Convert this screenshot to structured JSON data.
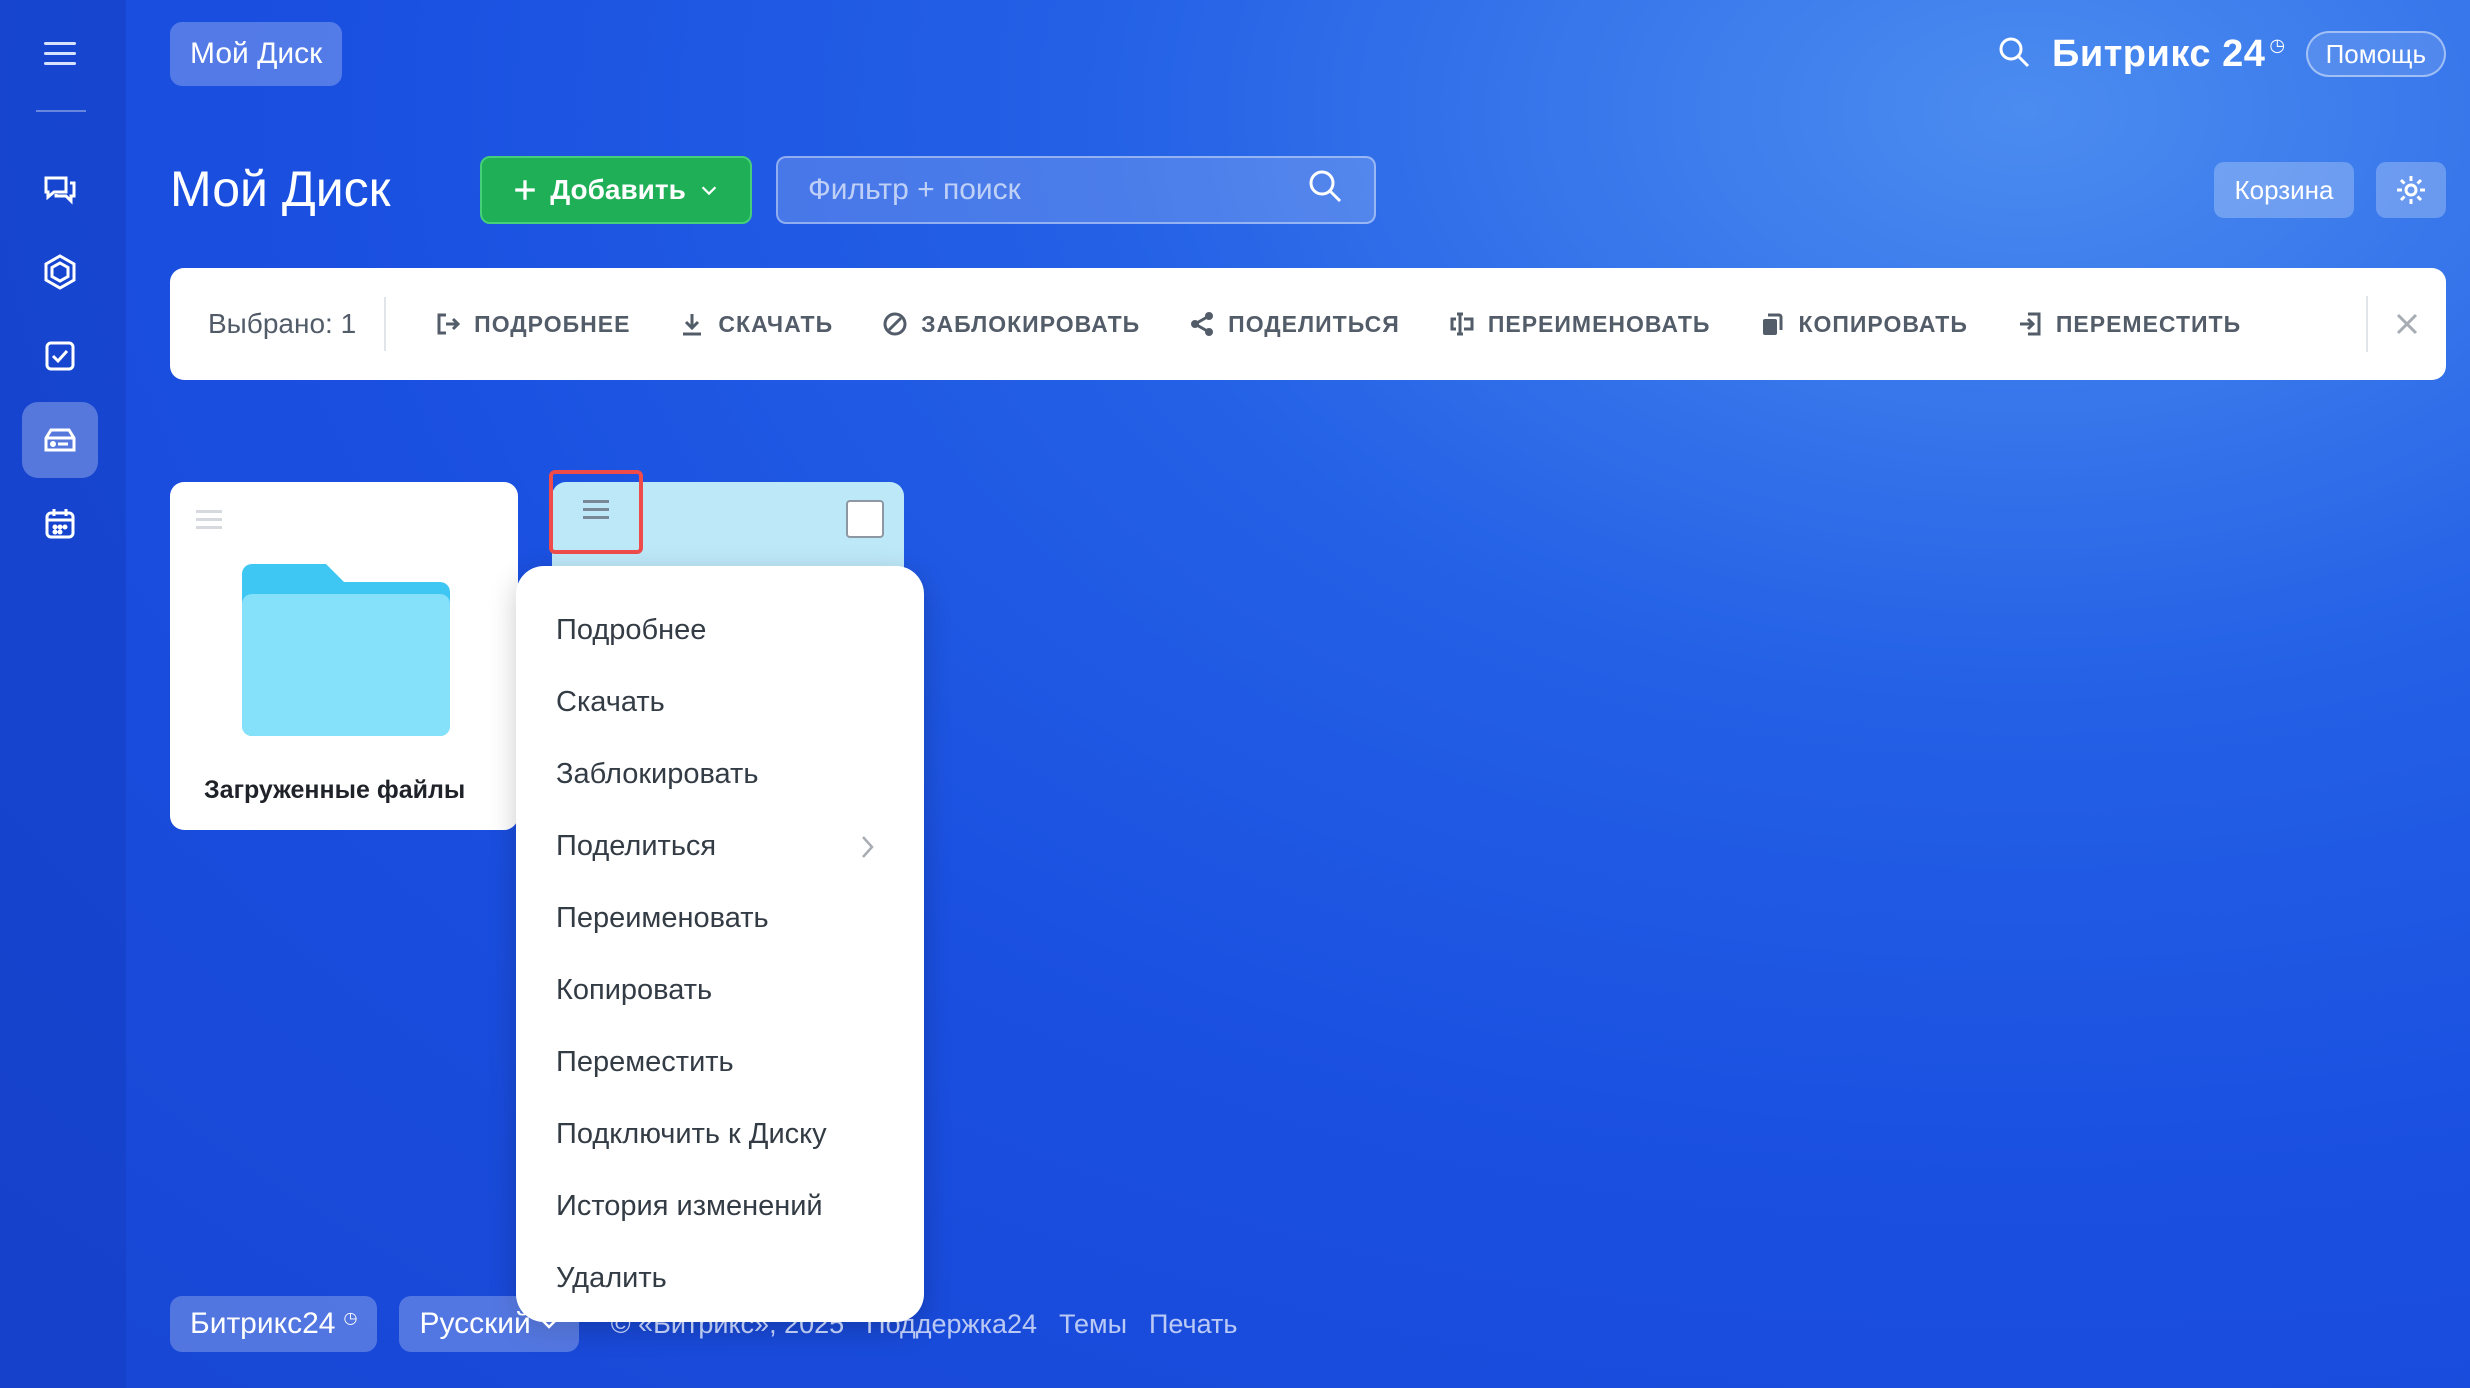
{
  "topbar": {
    "breadcrumb": "Мой Диск",
    "brand": "Битрикс 24",
    "brand_mark": "◷",
    "help_label": "Помощь"
  },
  "header": {
    "title": "Мой Диск",
    "add_label": "Добавить",
    "search_placeholder": "Фильтр + поиск",
    "trash_label": "Корзина"
  },
  "actionbar": {
    "selected": "Выбрано: 1",
    "actions": [
      {
        "label": "ПОДРОБНЕЕ",
        "icon": "details-icon"
      },
      {
        "label": "СКАЧАТЬ",
        "icon": "download-icon"
      },
      {
        "label": "ЗАБЛОКИРОВАТЬ",
        "icon": "block-icon"
      },
      {
        "label": "ПОДЕЛИТЬСЯ",
        "icon": "share-icon"
      },
      {
        "label": "ПЕРЕИМЕНОВАТЬ",
        "icon": "rename-icon"
      },
      {
        "label": "КОПИРОВАТЬ",
        "icon": "copy-icon"
      },
      {
        "label": "ПЕРЕМЕСТИТЬ",
        "icon": "move-icon"
      }
    ]
  },
  "files": {
    "folder_name": "Загруженные файлы"
  },
  "context_menu": {
    "items": [
      "Подробнее",
      "Скачать",
      "Заблокировать",
      "Поделиться",
      "Переименовать",
      "Копировать",
      "Переместить",
      "Подключить к Диску",
      "История изменений",
      "Удалить"
    ]
  },
  "footer": {
    "brand": "Битрикс24",
    "language": "Русский",
    "copyright": "© «Битрикс», 2025",
    "support": "Поддержка24",
    "themes": "Темы",
    "print": "Печать"
  },
  "colors": {
    "accent_green": "#1fb057",
    "highlight_red": "#ef4b4b",
    "selected_tile": "#bde8f8"
  }
}
